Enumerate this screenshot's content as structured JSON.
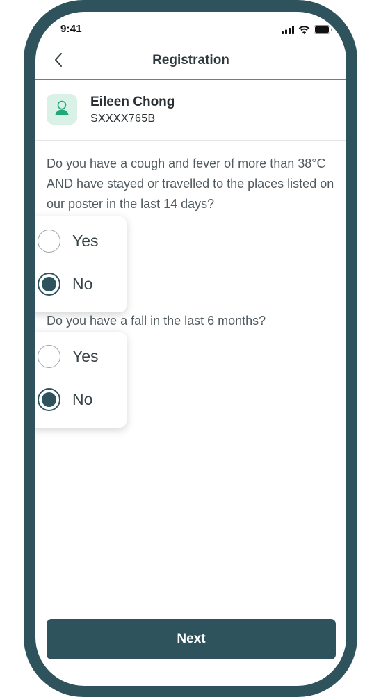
{
  "status_bar": {
    "time": "9:41",
    "icons": [
      "signal-icon",
      "wifi-icon",
      "battery-icon"
    ]
  },
  "nav": {
    "title": "Registration",
    "back_icon": "chevron-left-icon"
  },
  "patient": {
    "name": "Eileen Chong",
    "id": "SXXXX765B",
    "avatar_icon": "user-icon"
  },
  "questions": [
    {
      "text": "Do you have a cough and fever of more than 38°C AND have stayed or travelled to the places listed on our poster in the last 14 days?",
      "options": [
        "Yes",
        "No"
      ],
      "selected": "No"
    },
    {
      "text": "Do you have a fall in the last 6 months?",
      "options": [
        "Yes",
        "No"
      ],
      "selected": "No"
    }
  ],
  "footer": {
    "next_label": "Next"
  },
  "colors": {
    "frame": "#2f535d",
    "accent": "#1ea979",
    "avatar_bg": "#d9f1e6",
    "button": "#2f535d"
  }
}
